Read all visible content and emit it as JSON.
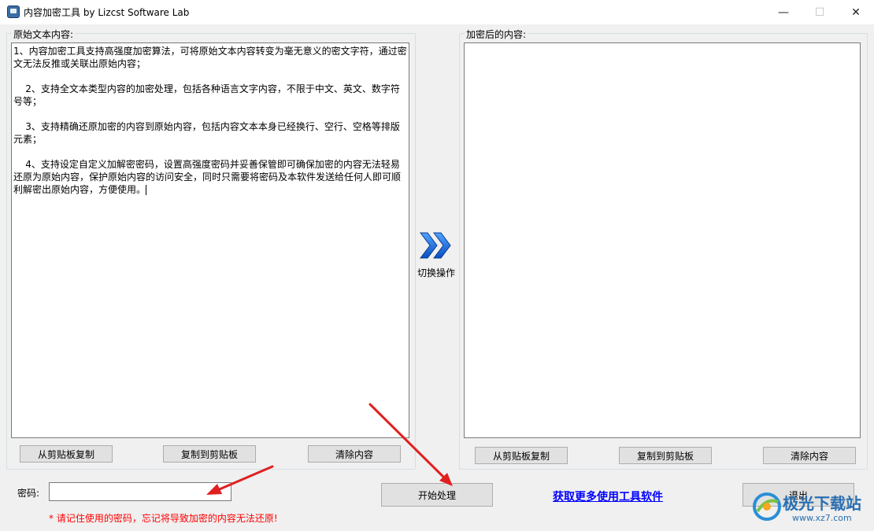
{
  "window": {
    "title": "内容加密工具   by Lizcst Software Lab",
    "minimize": "—",
    "maximize": "☐",
    "close": "✕"
  },
  "source_panel": {
    "label": "原始文本内容:",
    "text": "1、内容加密工具支持高强度加密算法，可将原始文本内容转变为毫无意义的密文字符，通过密文无法反推或关联出原始内容；\n\n    2、支持全文本类型内容的加密处理，包括各种语言文字内容，不限于中文、英文、数字符号等；\n\n    3、支持精确还原加密的内容到原始内容，包括内容文本本身已经换行、空行、空格等排版元素；\n\n    4、支持设定自定义加解密密码，设置高强度密码并妥善保管即可确保加密的内容无法轻易还原为原始内容，保护原始内容的访问安全，同时只需要将密码及本软件发送给任何人即可顺利解密出原始内容，方便使用。",
    "btn_paste": "从剪贴板复制",
    "btn_copy": "复制到剪贴板",
    "btn_clear": "清除内容"
  },
  "switch": {
    "label": "切换操作",
    "icon": "double-chevron-right-icon"
  },
  "result_panel": {
    "label": "加密后的内容:",
    "text": "",
    "btn_paste": "从剪贴板复制",
    "btn_copy": "复制到剪贴板",
    "btn_clear": "清除内容"
  },
  "password": {
    "label": "密码:",
    "value": "",
    "warning": "* 请记住使用的密码，忘记将导致加密的内容无法还原!"
  },
  "actions": {
    "start": "开始处理",
    "more_link": "获取更多使用工具软件",
    "exit": "退出"
  },
  "watermark": {
    "name": "极光下载站",
    "url": "www.xz7.com"
  },
  "colors": {
    "arrow": "#e02020",
    "link": "#0000ff",
    "warning": "#ff0000"
  }
}
